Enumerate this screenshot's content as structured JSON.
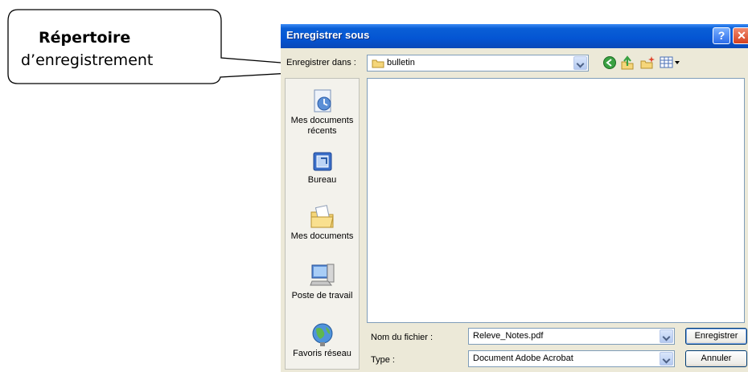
{
  "callout": {
    "title": "Répertoire",
    "text": "d’enregistrement"
  },
  "dialog": {
    "title": "Enregistrer sous",
    "help_label": "?",
    "close_label": "✕",
    "save_in_label": "Enregistrer dans :",
    "current_folder": "bulletin",
    "places": [
      {
        "label": "Mes documents récents",
        "icon": "recent-documents-icon"
      },
      {
        "label": "Bureau",
        "icon": "desktop-icon"
      },
      {
        "label": "Mes documents",
        "icon": "my-documents-icon"
      },
      {
        "label": "Poste de travail",
        "icon": "my-computer-icon"
      },
      {
        "label": "Favoris réseau",
        "icon": "network-places-icon"
      }
    ],
    "toolbar_icons": [
      "back-icon",
      "up-folder-icon",
      "new-folder-icon",
      "view-menu-icon"
    ],
    "filename_label": "Nom du fichier :",
    "filename_value": "Releve_Notes.pdf",
    "type_label": "Type :",
    "type_value": "Document Adobe Acrobat",
    "save_button": "Enregistrer",
    "cancel_button": "Annuler"
  }
}
